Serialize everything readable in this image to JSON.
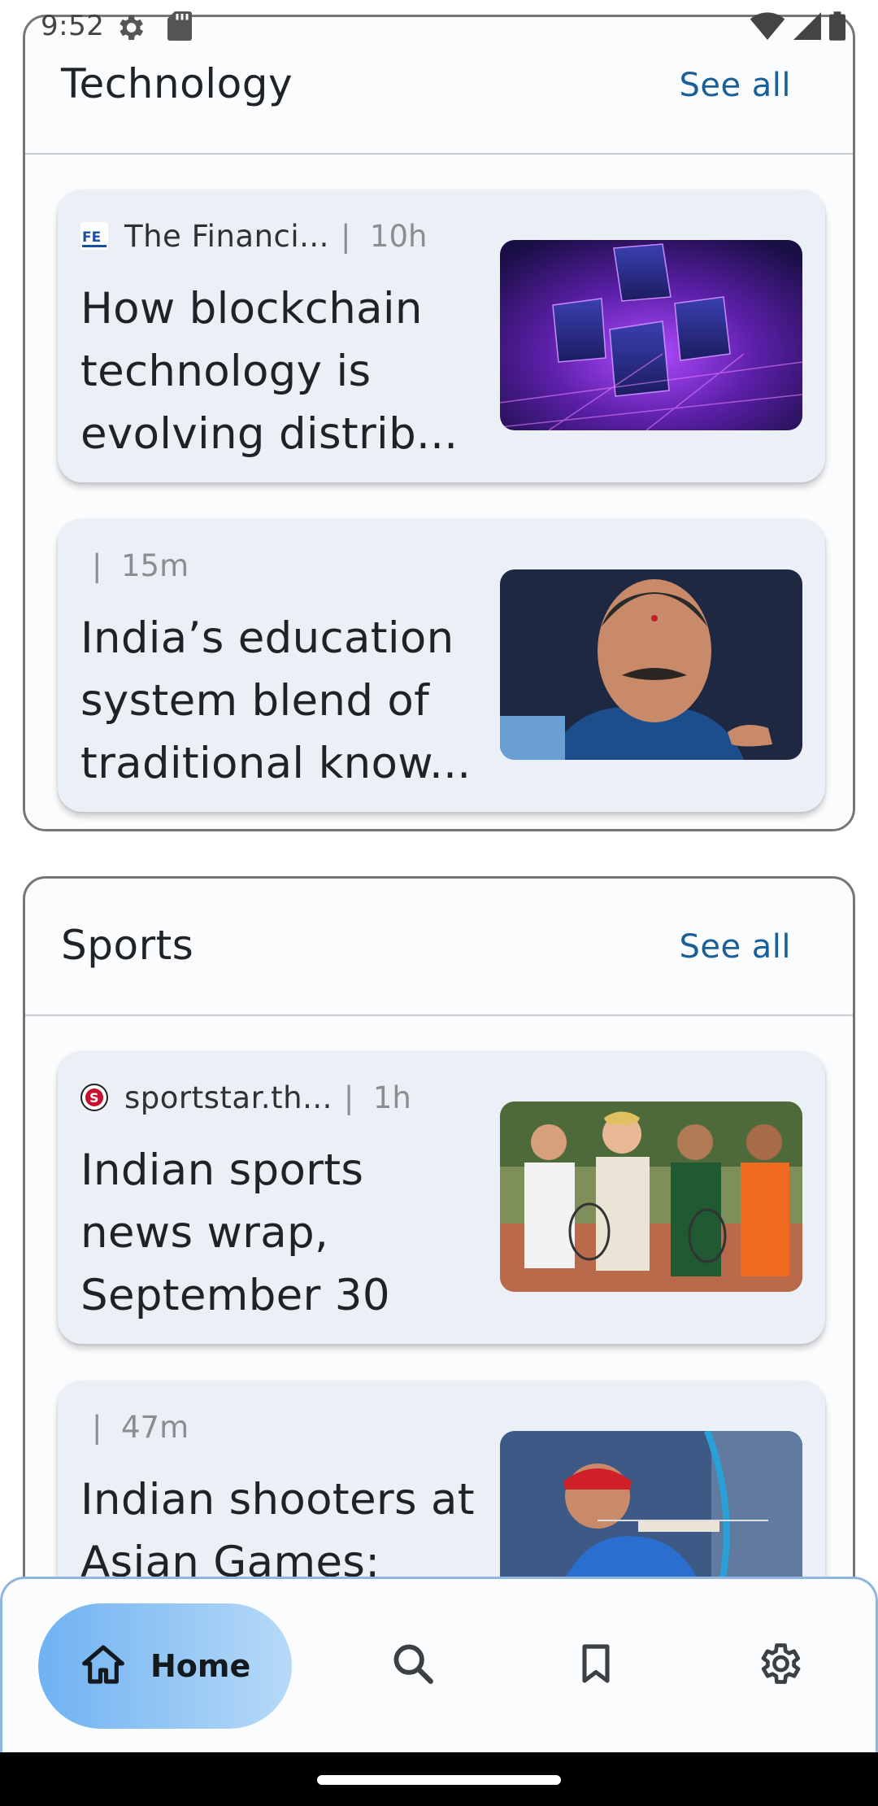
{
  "status_bar": {
    "time": "9:52"
  },
  "sections": [
    {
      "title": "Technology",
      "see_all": "See all",
      "cards": [
        {
          "source": "The Financi...",
          "separator_time": "|  10h",
          "title": "How blockchain technology is evolving distrib...",
          "logo_text": "FE",
          "image": "blockchain-cubes-image"
        },
        {
          "source": "",
          "separator_time": "|  15m",
          "title": "India’s education system blend of traditional know...",
          "image": "politician-portrait-image"
        }
      ]
    },
    {
      "title": "Sports",
      "see_all": "See all",
      "cards": [
        {
          "source": "sportstar.th...",
          "separator_time": "|  1h",
          "title": "Indian sports news wrap, September 30",
          "image": "tennis-players-group-image"
        },
        {
          "source": "",
          "separator_time": "|  47m",
          "title": "Indian shooters at Asian Games:",
          "image": "archer-aiming-image"
        }
      ]
    }
  ],
  "bottom_nav": {
    "home_label": "Home",
    "items": [
      "home-icon",
      "search-icon",
      "bookmark-icon",
      "settings-icon"
    ]
  },
  "colors": {
    "accent_link": "#1a5f97",
    "card_bg": "#eaf0f5",
    "home_pill_start": "#6fb2f2",
    "home_pill_end": "#b7daf7"
  }
}
